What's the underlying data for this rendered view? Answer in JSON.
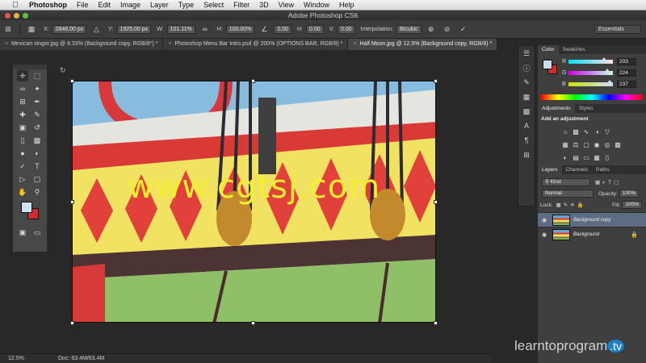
{
  "menubar": {
    "app": "Photoshop",
    "items": [
      "File",
      "Edit",
      "Image",
      "Layer",
      "Type",
      "Select",
      "Filter",
      "3D",
      "View",
      "Window",
      "Help"
    ]
  },
  "window": {
    "title": "Adobe Photoshop CS6"
  },
  "options": {
    "x_label": "X:",
    "x_value": "2848.00 px",
    "y_label": "Y:",
    "y_value": "1925.00 px",
    "w_label": "W:",
    "w_value": "101.11%",
    "h_label": "H:",
    "h_value": "100.00%",
    "angle_value": "0.00",
    "h2_label": "H:",
    "h2_value": "0.00",
    "v_label": "V:",
    "v_value": "0.00",
    "interp_label": "Interpolation:",
    "interp_value": "Bicubic",
    "workspace": "Essentials"
  },
  "tabs": [
    {
      "label": "Mexican singer.jpg @ 8.33% (Background copy, RGB/8*) *",
      "active": false
    },
    {
      "label": "Photoshop Menu Bar Intro.psd @ 200% (OPTIONS BAR, RGB/8) *",
      "active": false
    },
    {
      "label": "Half Moon.jpg @ 12.5% (Background copy, RGB/8) *",
      "active": true
    }
  ],
  "canvas": {
    "watermark": "www.cgtsj.com"
  },
  "status": {
    "zoom": "12.5%",
    "doc": "Doc: 63.4M/63.4M"
  },
  "color_panel": {
    "tabs": [
      "Color",
      "Swatches"
    ],
    "channels": [
      {
        "label": "R",
        "value": "203",
        "fraction": 0.796
      },
      {
        "label": "G",
        "value": "224",
        "fraction": 0.878
      },
      {
        "label": "B",
        "value": "237",
        "fraction": 0.929
      }
    ],
    "fg_color": "#cbe0ed",
    "bg_color": "#cb2e2e"
  },
  "adjustments_panel": {
    "tabs": [
      "Adjustments",
      "Styles"
    ],
    "title": "Add an adjustment"
  },
  "layers_panel": {
    "tabs": [
      "Layers",
      "Channels",
      "Paths"
    ],
    "filter_value": "Kind",
    "blend_mode": "Normal",
    "opacity_label": "Opacity:",
    "opacity_value": "100%",
    "lock_label": "Lock:",
    "fill_label": "Fill:",
    "fill_value": "100%",
    "layers": [
      {
        "name": "Background copy",
        "active": true
      },
      {
        "name": "Background",
        "active": false
      }
    ]
  },
  "logo": {
    "text": "learntoprogram",
    "suffix": ".tv"
  }
}
